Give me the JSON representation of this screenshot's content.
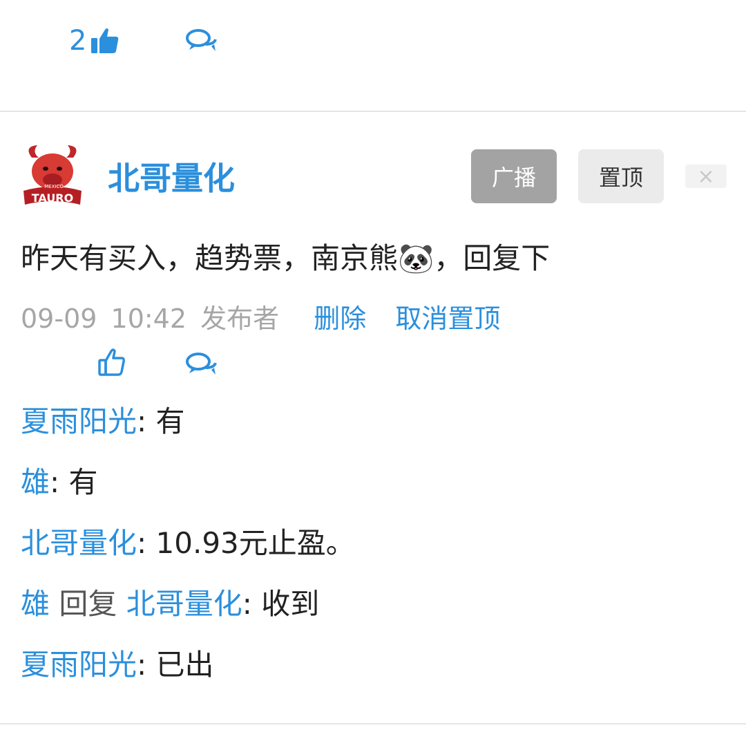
{
  "top_actions": {
    "like_count": "2"
  },
  "post": {
    "author": "北哥量化",
    "buttons": {
      "broadcast": "广播",
      "pin": "置顶",
      "close": "×"
    },
    "content": "昨天有买入，趋势票，南京熊🐼，回复下",
    "meta": {
      "date": "09-09",
      "time": "10:42",
      "publisher_label": "发布者",
      "delete_label": "删除",
      "unpin_label": "取消置顶"
    }
  },
  "replies": [
    {
      "user": "夏雨阳光",
      "sep": ":",
      "text": " 有"
    },
    {
      "user": "雄",
      "sep": ":",
      "text": " 有"
    },
    {
      "user": "北哥量化",
      "sep": ":",
      "text": " 10.93元止盈。"
    },
    {
      "user": "雄",
      "reply_label": " 回复 ",
      "target": "北哥量化",
      "sep": ":",
      "text": " 收到"
    },
    {
      "user": "夏雨阳光",
      "sep": ":",
      "text": " 已出"
    }
  ],
  "colors": {
    "link": "#2b8fdc",
    "meta": "#a6a6a6",
    "broadcast_bg": "#a3a3a3",
    "pin_bg": "#ebebeb"
  },
  "icons": [
    "thumbs-up-filled-icon",
    "comment-bubbles-icon",
    "thumbs-up-outline-icon",
    "close-icon"
  ]
}
